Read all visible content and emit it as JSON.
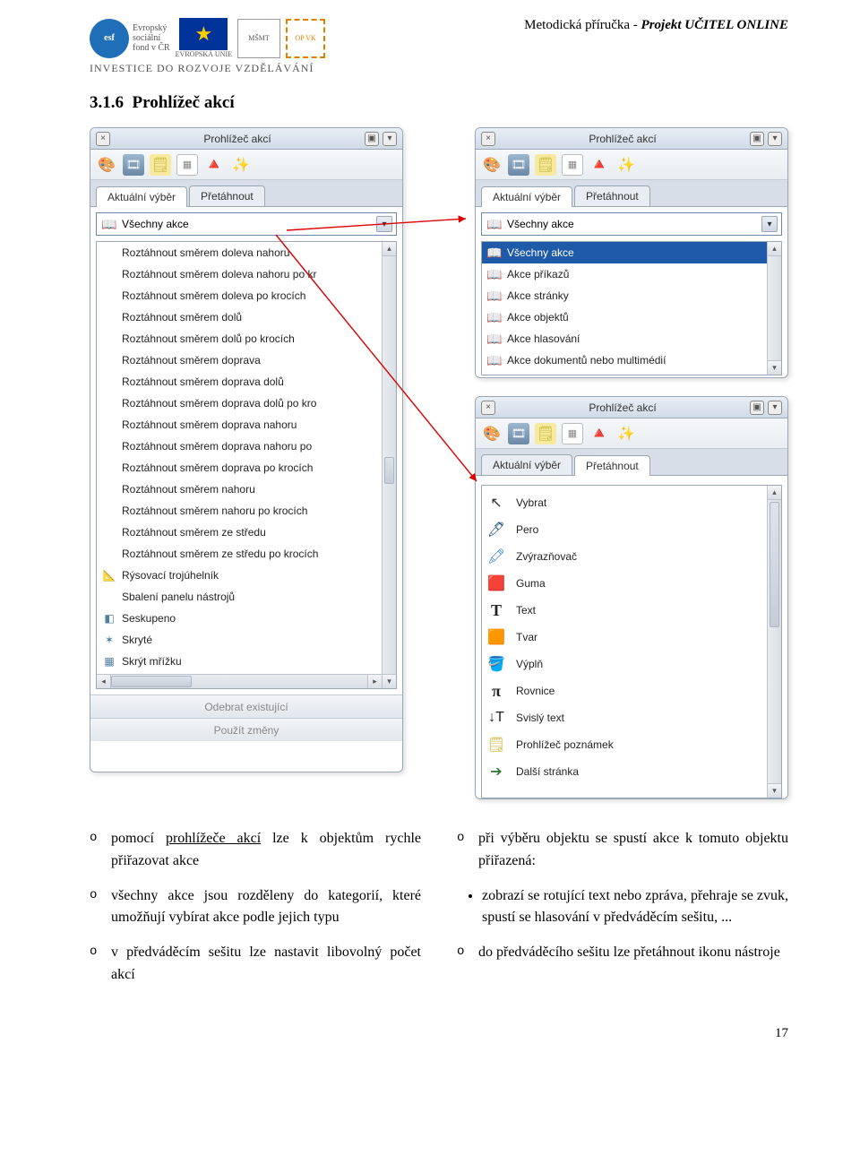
{
  "doc": {
    "header_left_invest": "INVESTICE DO ROZVOJE VZDĚLÁVÁNÍ",
    "header_right_1": "Metodická příručka - ",
    "header_right_2": "Projekt UČITEL ONLINE",
    "section_number": "3.1.6",
    "section_title": "Prohlížeč akcí",
    "esf_line1": "Evropský",
    "esf_line2": "sociální",
    "esf_line3": "fond v ČR",
    "eu_label": "EVROPSKÁ UNIE",
    "page_number": "17"
  },
  "panels": {
    "title": "Prohlížeč akcí",
    "tabs": {
      "current": "Aktuální výběr",
      "drag": "Přetáhnout"
    },
    "dropdown_label": "Všechny akce",
    "left_list": [
      "Roztáhnout směrem doleva nahoru",
      "Roztáhnout směrem doleva nahoru po kr",
      "Roztáhnout směrem doleva po krocích",
      "Roztáhnout směrem dolů",
      "Roztáhnout směrem dolů po krocích",
      "Roztáhnout směrem doprava",
      "Roztáhnout směrem doprava dolů",
      "Roztáhnout směrem doprava dolů po kro",
      "Roztáhnout směrem doprava nahoru",
      "Roztáhnout směrem doprava nahoru po",
      "Roztáhnout směrem doprava po krocích",
      "Roztáhnout směrem nahoru",
      "Roztáhnout směrem nahoru po krocích",
      "Roztáhnout směrem ze středu",
      "Roztáhnout směrem ze středu po krocích",
      "Rýsovací trojúhelník",
      "Sbalení panelu nástrojů",
      "Seskupeno",
      "Skryté",
      "Skrýt mřížku"
    ],
    "left_footer1": "Odebrat existující",
    "left_footer2": "Použít změny",
    "category_list": [
      "Všechny akce",
      "Akce příkazů",
      "Akce stránky",
      "Akce objektů",
      "Akce hlasování",
      "Akce dokumentů nebo multimédií"
    ],
    "tools_list": [
      {
        "label": "Vybrat",
        "icon": "cursor"
      },
      {
        "label": "Pero",
        "icon": "pen"
      },
      {
        "label": "Zvýrazňovač",
        "icon": "highlighter"
      },
      {
        "label": "Guma",
        "icon": "eraser"
      },
      {
        "label": "Text",
        "icon": "text"
      },
      {
        "label": "Tvar",
        "icon": "shape"
      },
      {
        "label": "Výplň",
        "icon": "fill"
      },
      {
        "label": "Rovnice",
        "icon": "pi"
      },
      {
        "label": "Svislý text",
        "icon": "vtext"
      },
      {
        "label": "Prohlížeč poznámek",
        "icon": "note"
      },
      {
        "label": "Další stránka",
        "icon": "next"
      }
    ]
  },
  "bullets": {
    "left": [
      {
        "pre": "pomocí ",
        "u": "prohlížeče akcí",
        "post": " lze k objektům rychle přiřazovat akce"
      },
      {
        "pre": "všechny akce jsou rozděleny do kategorií, které umožňují vybírat akce podle jejich typu",
        "u": "",
        "post": ""
      },
      {
        "pre": "v předváděcím sešitu lze nastavit libovolný počet akcí",
        "u": "",
        "post": ""
      }
    ],
    "right_head": "při výběru objektu se spustí akce k tomuto objektu přiřazená:",
    "right_sub": "zobrazí se rotující text nebo zpráva, přehraje se zvuk, spustí se hlasování v předváděcím sešitu, ...",
    "right_last": "do předváděcího sešitu lze přetáhnout ikonu nástroje"
  }
}
